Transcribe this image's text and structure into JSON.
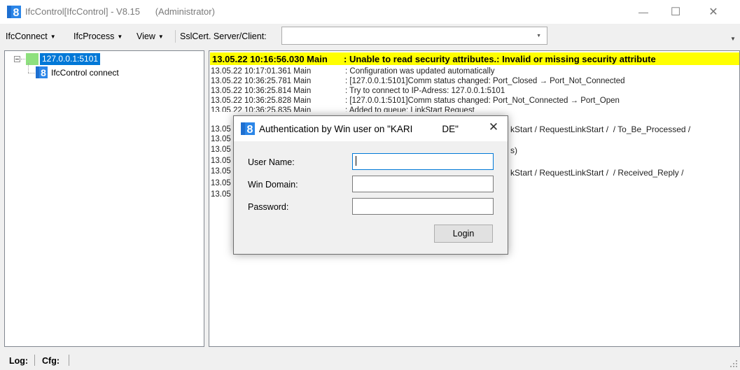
{
  "window": {
    "title": "IfcControl[IfcControl] - V8.15",
    "role": "(Administrator)",
    "icon": "ifc8-app-icon",
    "controls": {
      "minimize": "—",
      "maximize": "☐",
      "close": "✕"
    }
  },
  "toolbar": {
    "menus": [
      {
        "label": "IfcConnect",
        "caret": "▼"
      },
      {
        "label": "IfcProcess",
        "caret": "▼"
      },
      {
        "label": "View",
        "caret": "▼"
      }
    ],
    "ssl_label": "SslCert. Server/Client:",
    "ssl_value": "",
    "combo_arrow": "▼",
    "overflow": "▼"
  },
  "tree": {
    "root": {
      "label": "127.0.0.1:5101",
      "status_color": "#8ee07e"
    },
    "children": [
      {
        "label": "IfcControl connect"
      }
    ]
  },
  "log": {
    "highlight": {
      "timestamp": "13.05.22 10:16:56.030 Main",
      "message": ": Unable to read security attributes.: Invalid or missing security attribute",
      "color": "#ffff00"
    },
    "entries": [
      {
        "timestamp": "13.05.22 10:17:01.361 Main",
        "message": ": Configuration was updated automatically"
      },
      {
        "timestamp": "13.05.22 10:36:25.781 Main",
        "message": ": [127.0.0.1:5101]Comm status changed: Port_Closed → Port_Not_Connected"
      },
      {
        "timestamp": "13.05.22 10:36:25.814 Main",
        "message": ": Try to connect to IP-Adress: 127.0.0.1:5101"
      },
      {
        "timestamp": "13.05.22 10:36:25.828 Main",
        "message": ": [127.0.0.1:5101]Comm status changed: Port_Not_Connected → Port_Open"
      },
      {
        "timestamp": "13.05.22 10:36:25.835 Main",
        "message": ": Added to queue: LinkStart Request"
      }
    ],
    "partial_rows": [
      "13.05",
      "13.05",
      "13.05",
      "13.05",
      "13.05",
      "13.05",
      "13.05"
    ],
    "right_fragments": [
      "kStart / RequestLinkStart /  / To_Be_Processed /",
      "s)",
      "kStart / RequestLinkStart /  / Received_Reply /"
    ]
  },
  "bottom": {
    "log_label": "Log:",
    "cfg_label": "Cfg:"
  },
  "dialog": {
    "title_left": "Authentication by Win user on \"KARI",
    "title_right": "DE\"",
    "close": "✕",
    "fields": {
      "username": {
        "label": "User Name:",
        "value": ""
      },
      "domain": {
        "label": "Win Domain:",
        "value": ""
      },
      "password": {
        "label": "Password:",
        "value": ""
      }
    },
    "login_label": "Login"
  }
}
